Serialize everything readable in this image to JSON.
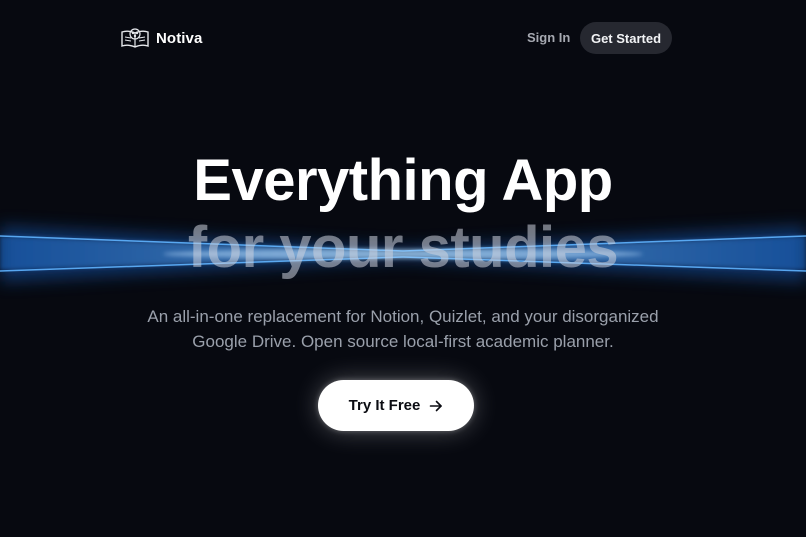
{
  "nav": {
    "brand": "Notiva",
    "sign_in": "Sign In",
    "get_started": "Get Started"
  },
  "hero": {
    "title_line1": "Everything App",
    "title_line2": "for your studies",
    "description_line1": "An all-in-one replacement for Notion, Quizlet, and your disorganized",
    "description_line2": "Google Drive. Open source local-first academic planner.",
    "cta_label": "Try It Free"
  },
  "icons": {
    "logo": "open-book-tree-icon",
    "cta": "arrow-right-icon"
  },
  "colors": {
    "background": "#070910",
    "beam": "#2a8cf0",
    "cta_background": "#ffffff",
    "nav_button_background": "#262830"
  }
}
